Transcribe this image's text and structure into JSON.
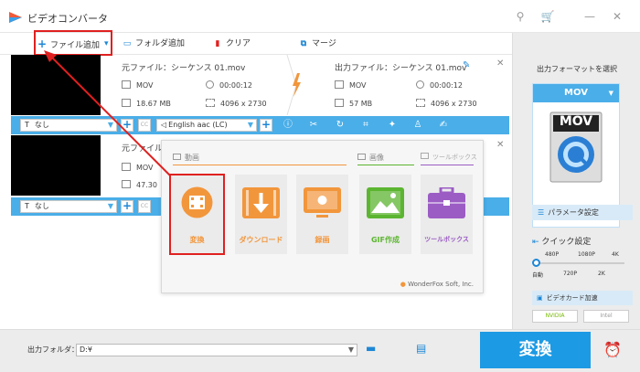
{
  "window": {
    "title": "ビデオコンバータ",
    "controls": [
      "pin-icon",
      "cart-icon",
      "minimize-icon",
      "close-icon"
    ]
  },
  "toolbar": {
    "add_file": "ファイル追加",
    "add_folder": "フォルダ追加",
    "clear": "クリア",
    "merge": "マージ"
  },
  "files": [
    {
      "source_label": "元ファイル：",
      "source_name": "シーケンス 01.mov",
      "source_format": "MOV",
      "source_duration": "00:00:12",
      "source_size": "18.67 MB",
      "source_resolution": "4096 x 2730",
      "output_label": "出力ファイル：",
      "output_name": "シーケンス 01.mov",
      "output_format": "MOV",
      "output_duration": "00:00:12",
      "output_size": "57 MB",
      "output_resolution": "4096 x 2730",
      "subtitle": "なし",
      "audio": "English aac (LC)"
    },
    {
      "source_label": "元ファイル",
      "source_format": "MOV",
      "source_size": "47.30",
      "subtitle": "なし"
    }
  ],
  "popup": {
    "groups": {
      "video": "動画",
      "image": "画像",
      "toolbox": "ツールボックス"
    },
    "tiles": [
      {
        "label": "変換",
        "color": "#f2963c"
      },
      {
        "label": "ダウンロード",
        "color": "#f2963c"
      },
      {
        "label": "録画",
        "color": "#f2963c"
      },
      {
        "label": "GIF作成",
        "color": "#5cb531"
      },
      {
        "label": "ツールボックス",
        "color": "#9b5cc4"
      }
    ],
    "brand": "WonderFox Soft, Inc."
  },
  "right_panel": {
    "format_title": "出力フォーマットを選択",
    "format_value": "MOV",
    "format_icon_text": "MOV",
    "params_btn": "パラメータ設定",
    "quick_label": "クイック設定",
    "slider_top": [
      "480P",
      "1080P",
      "4K"
    ],
    "slider_bottom": [
      "自動",
      "720P",
      "2K"
    ],
    "hw_accel": "ビデオカード加速",
    "gpu1": "NVIDIA",
    "gpu2": "Intel"
  },
  "bottom": {
    "folder_label": "出力フォルダ：",
    "folder_value": "D:¥",
    "convert": "変換"
  },
  "colors": {
    "accent_blue": "#4aaee8",
    "convert_blue": "#1d9ae4",
    "highlight_red": "#e02020",
    "orange": "#f2963c",
    "green": "#5cb531",
    "purple": "#9b5cc4"
  }
}
